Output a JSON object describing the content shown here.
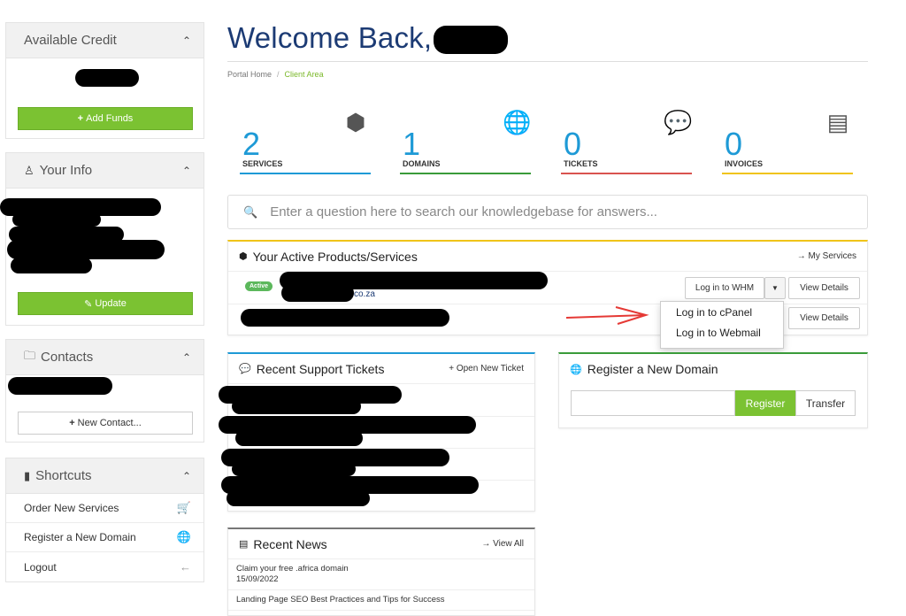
{
  "sidebar": {
    "credit": {
      "title": "Available Credit",
      "add_funds": "Add Funds"
    },
    "info": {
      "title": "Your Info",
      "update": "Update"
    },
    "contacts": {
      "title": "Contacts",
      "new_contact": "New Contact..."
    },
    "shortcuts": {
      "title": "Shortcuts",
      "items": [
        {
          "label": "Order New Services",
          "icon": "cart-icon"
        },
        {
          "label": "Register a New Domain",
          "icon": "globe-icon"
        },
        {
          "label": "Logout",
          "icon": "arrow-left-icon"
        }
      ]
    }
  },
  "header": {
    "title": "Welcome Back,"
  },
  "breadcrumb": {
    "home": "Portal Home",
    "separator": "/",
    "current": "Client Area"
  },
  "stats": [
    {
      "value": "2",
      "label": "SERVICES",
      "icon": "cube-icon",
      "color": "#1e9ad6"
    },
    {
      "value": "1",
      "label": "DOMAINS",
      "icon": "globe-icon",
      "color": "#3a9b3a"
    },
    {
      "value": "0",
      "label": "TICKETS",
      "icon": "comments-icon",
      "color": "#d9534f"
    },
    {
      "value": "0",
      "label": "INVOICES",
      "icon": "credit-card-icon",
      "color": "#f0c419"
    }
  ],
  "search": {
    "placeholder": "Enter a question here to search our knowledgebase for answers..."
  },
  "products": {
    "title": "Your Active Products/Services",
    "link": "My Services",
    "items": [
      {
        "status": "Active",
        "domain_suffix": "co.za",
        "login_whm": "Log in to WHM",
        "view": "View Details"
      },
      {
        "view": "View Details"
      }
    ],
    "dropdown": [
      "Log in to cPanel",
      "Log in to Webmail"
    ]
  },
  "tickets": {
    "title": "Recent Support Tickets",
    "link": "Open New Ticket"
  },
  "domain": {
    "title": "Register a New Domain",
    "register": "Register",
    "transfer": "Transfer"
  },
  "news": {
    "title": "Recent News",
    "link": "View All",
    "items": [
      {
        "title": "Claim your free .africa domain",
        "date": "15/09/2022"
      },
      {
        "title": "Landing Page SEO Best Practices and Tips for Success"
      }
    ]
  }
}
